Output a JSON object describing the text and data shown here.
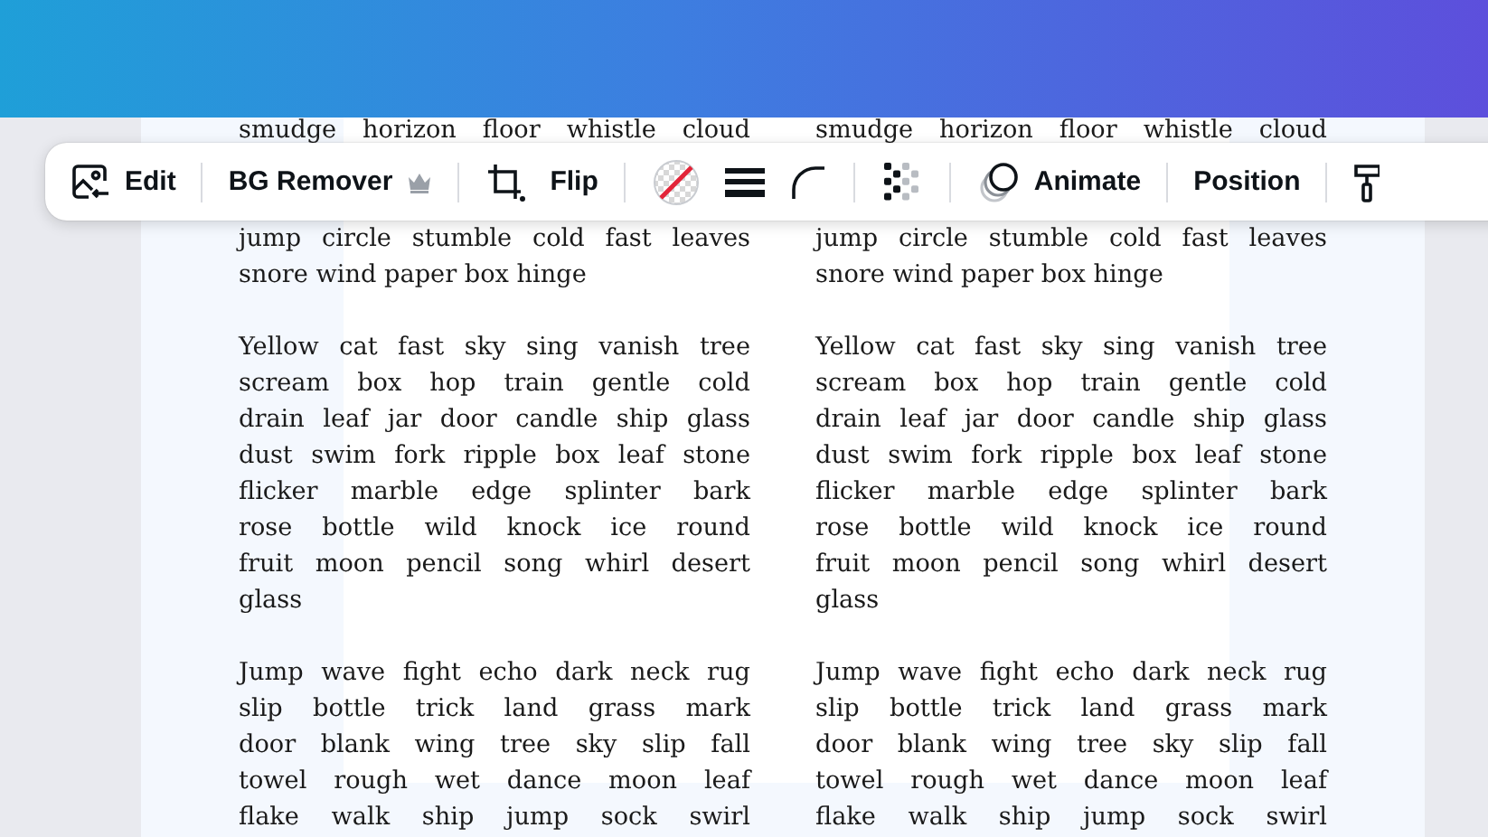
{
  "toolbar": {
    "items": [
      {
        "kind": "edit",
        "label": "Edit"
      },
      {
        "kind": "divider"
      },
      {
        "kind": "bg-remover",
        "label": "BG Remover",
        "premium": true
      },
      {
        "kind": "divider"
      },
      {
        "kind": "crop"
      },
      {
        "kind": "flip",
        "label": "Flip"
      },
      {
        "kind": "divider"
      },
      {
        "kind": "color"
      },
      {
        "kind": "stroke"
      },
      {
        "kind": "corner"
      },
      {
        "kind": "divider"
      },
      {
        "kind": "transparency"
      },
      {
        "kind": "divider"
      },
      {
        "kind": "animate",
        "label": "Animate"
      },
      {
        "kind": "divider"
      },
      {
        "kind": "position",
        "label": "Position"
      },
      {
        "kind": "divider"
      },
      {
        "kind": "style"
      }
    ]
  },
  "columns": [
    {
      "paragraphs": [
        {
          "lines": [
            "smudge horizon floor whistle cloud"
          ],
          "justified_end": true
        },
        {
          "lines": [
            "jump circle stumble cold fast leaves",
            "snore wind paper box hinge"
          ],
          "justified_end": false
        },
        {
          "lines": [
            "Yellow cat fast sky sing vanish tree",
            "scream box hop train gentle cold",
            "drain leaf jar door candle ship glass",
            "dust swim fork ripple box leaf stone",
            "flicker marble edge splinter bark",
            "rose bottle wild knock ice round",
            "fruit moon pencil song whirl desert",
            "glass"
          ]
        },
        {
          "lines": [
            "Jump wave fight echo dark neck rug",
            "slip bottle trick land grass mark",
            "door blank wing tree sky slip fall",
            "towel rough wet dance moon leaf",
            "flake walk ship jump sock swirl"
          ],
          "justified_end": true
        }
      ]
    },
    {
      "paragraphs": [
        {
          "lines": [
            "smudge horizon floor whistle cloud"
          ],
          "justified_end": true
        },
        {
          "lines": [
            "jump circle stumble cold fast leaves",
            "snore wind paper box hinge"
          ],
          "justified_end": false
        },
        {
          "lines": [
            "Yellow cat fast sky sing vanish tree",
            "scream box hop train gentle cold",
            "drain leaf jar door candle ship glass",
            "dust swim fork ripple box leaf stone",
            "flicker marble edge splinter bark",
            "rose bottle wild knock ice round",
            "fruit moon pencil song whirl desert",
            "glass"
          ]
        },
        {
          "lines": [
            "Jump wave fight echo dark neck rug",
            "slip bottle trick land grass mark",
            "door blank wing tree sky slip fall",
            "towel rough wet dance moon leaf",
            "flake walk ship jump sock swirl"
          ],
          "justified_end": true
        }
      ]
    }
  ]
}
